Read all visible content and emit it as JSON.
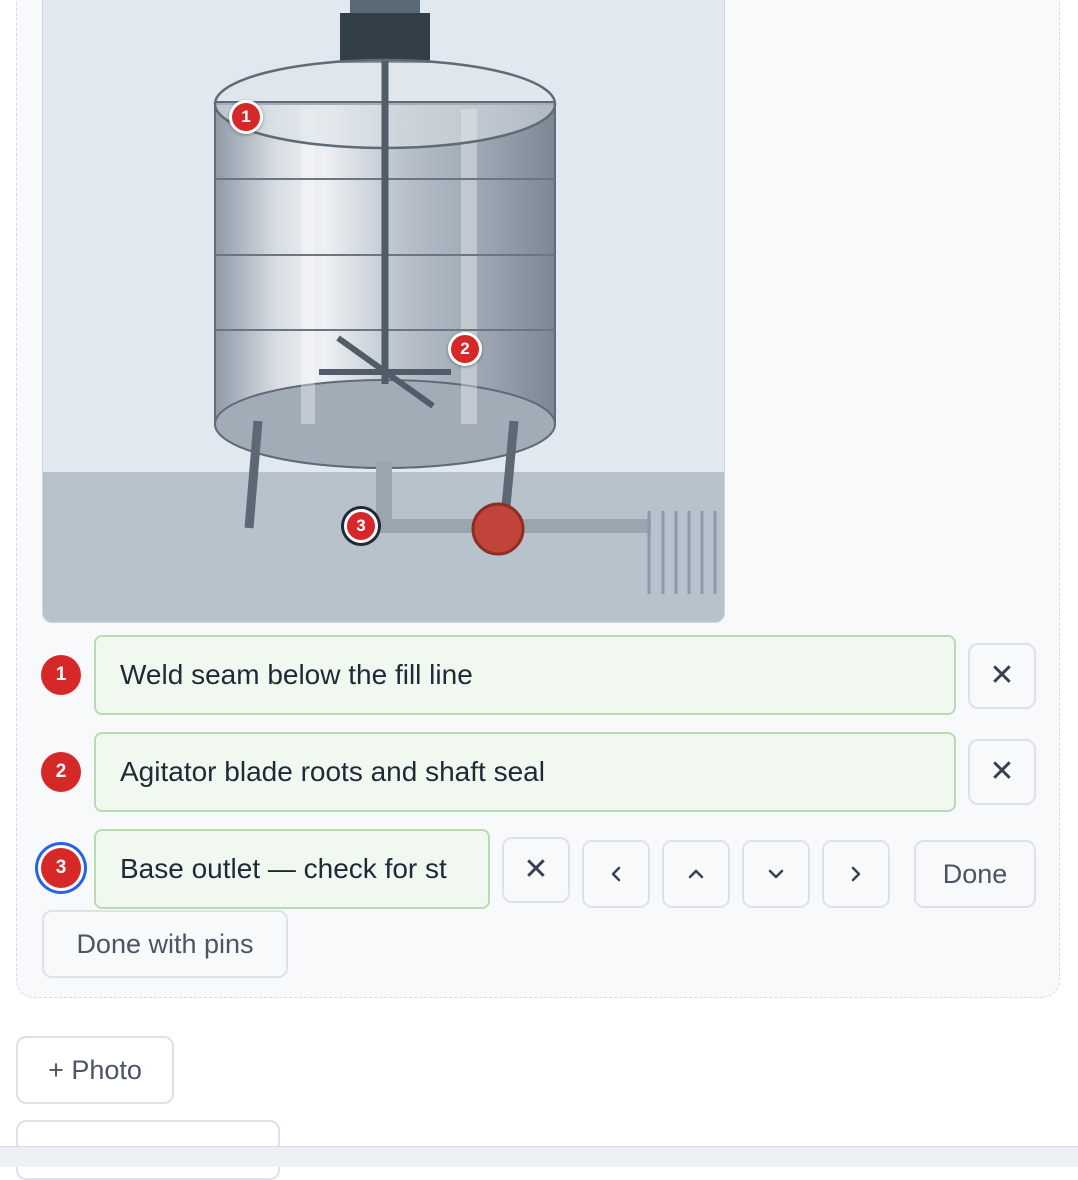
{
  "pins": [
    {
      "number": "1",
      "note": "Weld seam below the fill line"
    },
    {
      "number": "2",
      "note": "Agitator blade roots and shaft seal"
    },
    {
      "number": "3",
      "note": "Base outlet — check for st"
    }
  ],
  "active_pin": "3",
  "controls": {
    "remove_icon": "close-icon",
    "left_icon": "chevron-left-icon",
    "up_icon": "chevron-up-icon",
    "down_icon": "chevron-down-icon",
    "right_icon": "chevron-right-icon",
    "done_label": "Done",
    "done_with_pins_label": "Done with pins"
  },
  "actions": {
    "add_photo_label": "+ Photo"
  },
  "colors": {
    "pin": "#d62828",
    "note_bg": "#f1f8ef",
    "note_border": "#b6ddb0",
    "active_ring": "#2563eb"
  }
}
